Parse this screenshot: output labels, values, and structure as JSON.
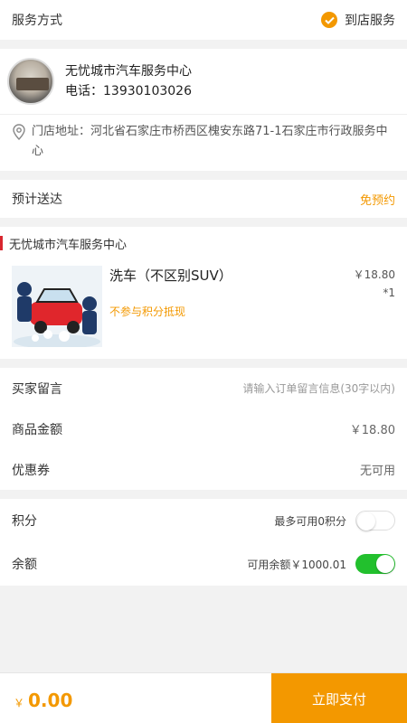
{
  "service": {
    "label": "服务方式",
    "value": "到店服务"
  },
  "store": {
    "name": "无忧城市汽车服务中心",
    "phone": "电话：13930103026",
    "address": "门店地址：河北省石家庄市桥西区槐安东路71-1石家庄市行政服务中心"
  },
  "eta": {
    "label": "预计送达",
    "value": "免预约"
  },
  "shop": {
    "title": "无忧城市汽车服务中心",
    "item": {
      "name": "洗车（不区别SUV）",
      "price": "￥18.80",
      "qty": "*1",
      "note": "不参与积分抵现"
    }
  },
  "info": {
    "message_label": "买家留言",
    "message_placeholder": "请输入订单留言信息(30字以内)",
    "amount_label": "商品金额",
    "amount_value": "￥18.80",
    "coupon_label": "优惠券",
    "coupon_value": "无可用"
  },
  "points": {
    "points_label": "积分",
    "points_value": "最多可用0积分",
    "points_on": false,
    "balance_label": "余额",
    "balance_value": "可用余额￥1000.01",
    "balance_on": true
  },
  "footer": {
    "currency": "￥",
    "total": "0.00",
    "pay_label": "立即支付"
  },
  "colors": {
    "accent": "#f39800",
    "toggle_on": "#22c02d",
    "shop_bar": "#d8262e"
  }
}
